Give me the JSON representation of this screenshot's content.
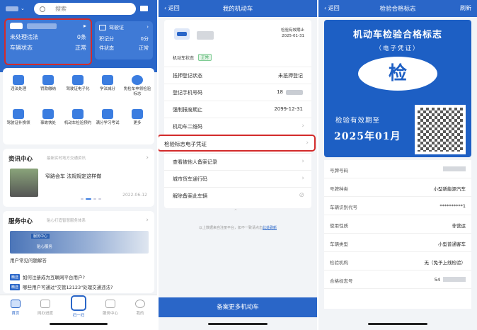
{
  "screen1": {
    "search_placeholder": "搜索",
    "card1": {
      "line1_label": "未处理违法",
      "line1_value": "0条",
      "line2_label": "车辆状态",
      "line2_value": "正常"
    },
    "card2": {
      "title": "驾驶证",
      "r1_label": "积记分",
      "r1_value": "0分",
      "r2_label": "件状态",
      "r2_value": "正常"
    },
    "grid": [
      {
        "label": "违法处理"
      },
      {
        "label": "罚款缴纳"
      },
      {
        "label": "驾驶证电子化"
      },
      {
        "label": "学法减分"
      },
      {
        "label": "免检车申领检验标志"
      },
      {
        "label": "驾驶证补换领"
      },
      {
        "label": "事故快处"
      },
      {
        "label": "机动车检验预约"
      },
      {
        "label": "满分学习考试"
      },
      {
        "label": "更多"
      }
    ],
    "news": {
      "title": "资讯中心",
      "subtitle": "最新实时地方交通资讯",
      "headline": "窄路会车 法规规定这样做",
      "date": "2022-06-12"
    },
    "service": {
      "title": "服务中心",
      "subtitle": "贴心打造智慧服务体系",
      "banner_tag": "服务中心",
      "banner_label": "贴心服务",
      "caption": "用户常见问题解答",
      "q1": "如何注册成为互联网平台用户?",
      "q2": "哪些用户可通过\"交管12123\"处理交通违法?",
      "q_badge": "精选"
    },
    "tabs": [
      {
        "label": "首页"
      },
      {
        "label": "网办进度"
      },
      {
        "label": "扫一扫"
      },
      {
        "label": "服务中心"
      },
      {
        "label": "我的"
      }
    ]
  },
  "screen2": {
    "back": "返回",
    "title": "我的机动车",
    "due_label": "检验有效期止",
    "due_date": "2025-01-31",
    "status_label": "机动车状态",
    "status_value": "正常",
    "rows": [
      {
        "label": "抵押登记状态",
        "value": "未抵押登记"
      },
      {
        "label": "登记手机号码",
        "value": "18"
      },
      {
        "label": "强制报废期止",
        "value": "2099-12-31"
      },
      {
        "label": "机动车二维码",
        "value": ""
      }
    ],
    "highlight": "检验标志电子凭证",
    "rows2": [
      {
        "label": "查看被他人备案记录"
      },
      {
        "label": "城市货车通行码"
      },
      {
        "label": "解除备案此车辆"
      }
    ],
    "note_text": "以上数据来自注册平台，如不一致请点击",
    "note_link": "此处刷新",
    "bottom_button": "备案更多机动车"
  },
  "screen3": {
    "back": "返回",
    "title": "检验合格标志",
    "refresh": "刷新",
    "cert_title": "机动车检验合格标志",
    "cert_sub": "（电子凭证）",
    "seal": "检",
    "valid_label": "检验有效期至",
    "valid_date": "2025年01月",
    "rows": [
      {
        "label": "号牌号码",
        "value": ""
      },
      {
        "label": "号牌种类",
        "value": "小型新能源汽车"
      },
      {
        "label": "车辆识别代号",
        "value": "**********1"
      },
      {
        "label": "使用性质",
        "value": "非营运"
      },
      {
        "label": "车辆类型",
        "value": "小型普通客车"
      },
      {
        "label": "检验机构",
        "value": "无（免予上线检验）"
      },
      {
        "label": "合格标志号",
        "value": "54"
      }
    ]
  }
}
